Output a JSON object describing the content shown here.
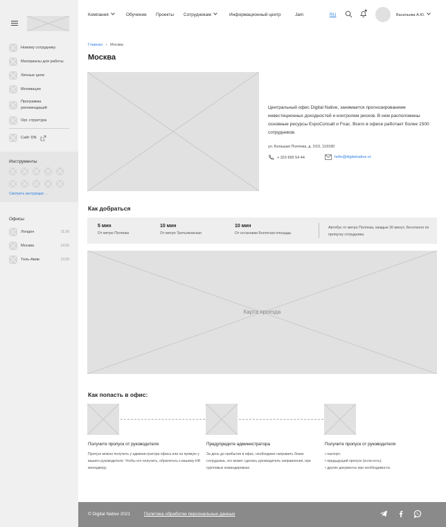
{
  "sidebar": {
    "items": [
      {
        "label": "Новому сотруднику"
      },
      {
        "label": "Материалы для работы"
      },
      {
        "label": "Личные цели"
      },
      {
        "label": "Мотивация"
      },
      {
        "label": "Программа рекомендаций"
      },
      {
        "label": "Орг. структура"
      },
      {
        "label": "Сайт DN"
      }
    ],
    "tools_title": "Инструменты",
    "tools_link": "Смотреть инструкции →",
    "offices_title": "Офисы",
    "offices": [
      {
        "name": "Лондон",
        "time": "11:30"
      },
      {
        "name": "Москва",
        "time": "14:30"
      },
      {
        "name": "Тель-Авив",
        "time": "13:30"
      }
    ]
  },
  "header": {
    "nav": [
      {
        "label": "Компания"
      },
      {
        "label": "Обучение"
      },
      {
        "label": "Проекты"
      },
      {
        "label": "Сотрудникам"
      },
      {
        "label": "Информационный центр"
      },
      {
        "label": "Jam"
      }
    ],
    "lang": "RU",
    "user": "Васильева А.Ю."
  },
  "breadcrumb": {
    "home": "Главная",
    "sep": ">",
    "current": "Москва"
  },
  "page_title": "Москва",
  "office": {
    "description": "Центральный офис Digital Native, занимается прогнозированием инвестиционных доходностей и контролем рисков. В нем расположены основные ресурсы ExpoConsalt и Fnac. Всего в офисе работает более 1500 сотрудников.",
    "address": "ул. Большая Полянка, д. 2/10, 119180",
    "phone": "+ 323 655 54 44",
    "email": "hello@digitalnative.vc"
  },
  "directions": {
    "title": "Как добраться",
    "routes": [
      {
        "time": "5 мин",
        "desc": "От метро Полянка"
      },
      {
        "time": "10 мин",
        "desc": "От метро Третьяковская"
      },
      {
        "time": "10 мин",
        "desc": "От остановки Болотная площадь"
      }
    ],
    "bus_note": "Автобус от метро Полянка, каждые 30 минут, бесплатно по пропуску сотрудника.",
    "map_label": "Карта проезда"
  },
  "access": {
    "title": "Как попасть в офис:",
    "steps": [
      {
        "title": "Получите пропуск от руководителя",
        "text": "Пропуск можно получить у администратора офиса или на прямую у вашего руководителя. Чтобы его получить, обратитесь к вашему HR менеджеру."
      },
      {
        "title": "Предупредите администратора",
        "text": "За день до прибытия в офис, необходимо направить бланк сотрудника, это может сделать руководитель направления, при групповых командировках."
      },
      {
        "title": "Получите пропуск от руководителя",
        "list": [
          "паспорт;",
          "предыдущий пропуск (если есть);",
          "другие документы при необходимости."
        ]
      }
    ]
  },
  "footer": {
    "copyright": "© Digital Native 2021",
    "privacy": "Политика обработки персональных данных"
  }
}
